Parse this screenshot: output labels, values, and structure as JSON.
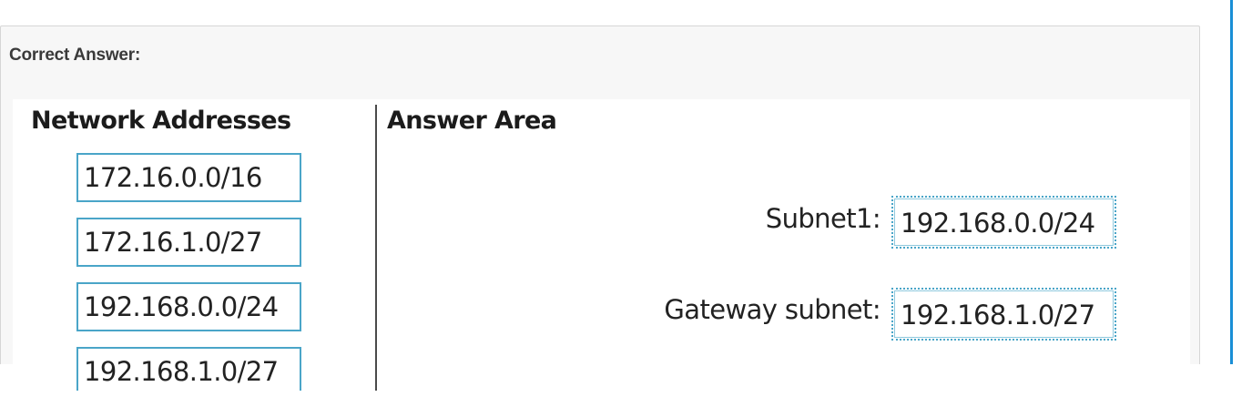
{
  "header": {
    "label": "Correct Answer:"
  },
  "left_column": {
    "title": "Network Addresses",
    "items": [
      {
        "value": "172.16.0.0/16"
      },
      {
        "value": "172.16.1.0/27"
      },
      {
        "value": "192.168.0.0/24"
      },
      {
        "value": "192.168.1.0/27"
      }
    ]
  },
  "right_column": {
    "title": "Answer Area",
    "fields": [
      {
        "label": "Subnet1:",
        "value": "192.168.0.0/24"
      },
      {
        "label": "Gateway subnet:",
        "value": "192.168.1.0/27"
      }
    ]
  },
  "colors": {
    "accent_rule": "#1a8fd6",
    "box_border": "#4aa5c8",
    "panel_bg": "#f7f7f7"
  }
}
